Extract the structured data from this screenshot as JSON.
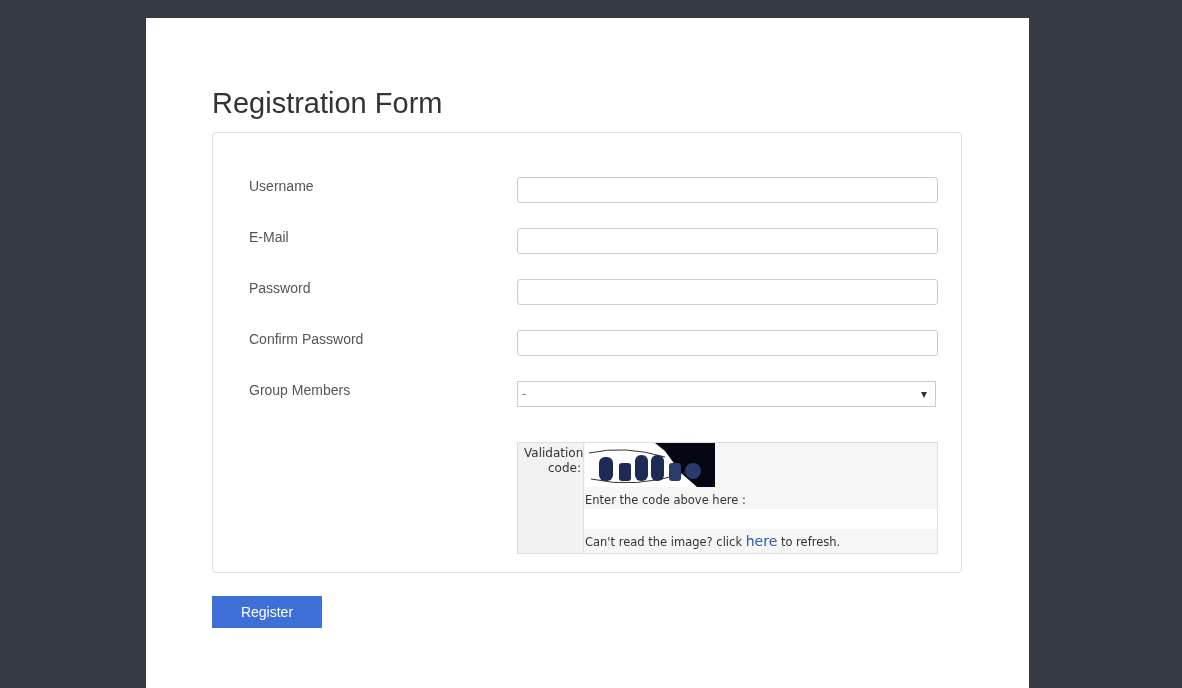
{
  "title": "Registration Form",
  "fields": [
    {
      "label": "Username",
      "kind": "text"
    },
    {
      "label": "E-Mail",
      "kind": "text"
    },
    {
      "label": "Password",
      "kind": "text"
    },
    {
      "label": "Confirm Password",
      "kind": "text"
    },
    {
      "label": "Group Members",
      "kind": "select",
      "value": "-",
      "caret": "▾"
    }
  ],
  "captcha": {
    "label": "Validation code:",
    "prompt": "Enter the code above here :",
    "refresh_before": "Can't read the image? click ",
    "refresh_link": "here",
    "refresh_after": " to refresh."
  },
  "submit": "Register"
}
